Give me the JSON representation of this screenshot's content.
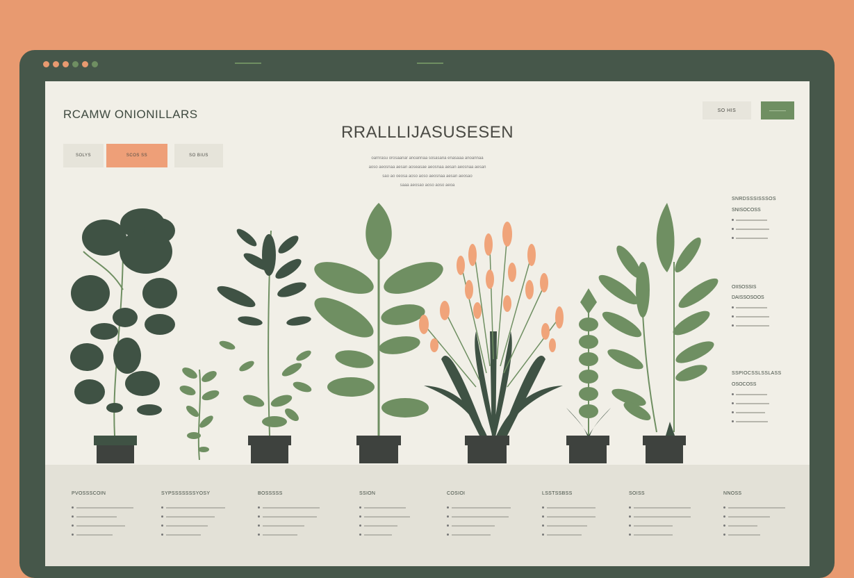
{
  "app": {
    "brand": "RCAMW ONIONILLARS",
    "header_buttons": [
      "SO HIS",
      ""
    ]
  },
  "tabs": [
    {
      "label": "SOLYS",
      "active": false
    },
    {
      "label": "SCOS  SS",
      "active": true
    },
    {
      "label": "SO BIUS",
      "active": false
    }
  ],
  "hero": {
    "title": "RRALLLIJASUSESEN",
    "lines": [
      "oarnrasu orosaanar anoannaa sosasana enasaaa anoannaa",
      "aoso aeosnaa aesan aoseasae aeosnaa aesan aeosnaa aesan",
      "sao ao oeosa aoso aoso aeosnaa aesan aeosao",
      "saaa aeosao aoso aoso aeoa"
    ]
  },
  "sidebar": [
    {
      "title": "SNRDSSSISSSOS",
      "subtitle": "SNISOCOSS",
      "items": 3
    },
    {
      "title": "",
      "subtitle": "OIISOSSIS",
      "sub2": "DAISSOSOOS",
      "items": 3
    },
    {
      "title": "SSPIOCSSLSSLASS",
      "subtitle": "OSOCOSS",
      "items": 4
    }
  ],
  "footer": {
    "columns": [
      {
        "head": "PVOSSSCOIN",
        "items": 4
      },
      {
        "head": "SYPSSSSSSSYOSY",
        "items": 4
      },
      {
        "head": "BOSSSSS",
        "items": 4
      },
      {
        "head": "SSION",
        "items": 4
      },
      {
        "head": "COSIOI",
        "items": 4
      },
      {
        "head": "LSSTSSBSS",
        "items": 4
      },
      {
        "head": "SOISS",
        "items": 4
      },
      {
        "head": "NNOSS",
        "items": 4
      }
    ]
  },
  "colors": {
    "background": "#e89a70",
    "bezel": "#46574a",
    "screen": "#f1efe7",
    "accent_green": "#6f8f62",
    "accent_orange": "#ee9f78",
    "dark_leaf": "#3f5244",
    "pot": "#3e423e",
    "flower": "#f0a47a"
  },
  "window_dots": [
    "#e89a70",
    "#e89a70",
    "#e89a70",
    "#6f8f62",
    "#e89a70",
    "#6f8f62"
  ]
}
